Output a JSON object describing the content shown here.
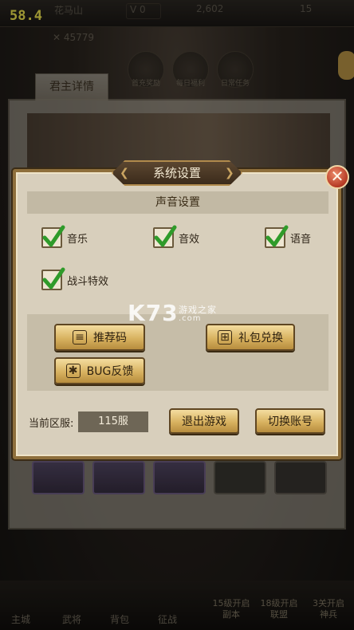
{
  "fps": "58.4",
  "topbar": {
    "lord_name": "花马山",
    "vip": "V 0",
    "coins": "2,602",
    "gems": "15",
    "power": "45779"
  },
  "background_icons": [
    "首充奖励",
    "每日福利",
    "日常任务"
  ],
  "lord_tab": "君主详情",
  "bottom_nav": {
    "items": [
      "主城",
      "武将",
      "背包",
      "征战"
    ],
    "locked": [
      {
        "line1": "15级开启",
        "line2": "副本"
      },
      {
        "line1": "18级开启",
        "line2": "联盟"
      },
      {
        "line1": "3关开启",
        "line2": "神兵"
      }
    ]
  },
  "dialog": {
    "title": "系统设置",
    "sound_section": "声音设置",
    "checkboxes": [
      {
        "label": "音乐",
        "checked": true
      },
      {
        "label": "音效",
        "checked": true
      },
      {
        "label": "语音",
        "checked": true
      },
      {
        "label": "战斗特效",
        "checked": true
      }
    ],
    "buttons": {
      "referral": "推荐码",
      "gift_redeem": "礼包兑换",
      "bug_report": "BUG反馈",
      "exit_game": "退出游戏",
      "switch_account": "切换账号"
    },
    "server_label": "当前区服:",
    "server_value": "115服"
  },
  "watermark": {
    "brand": "K73",
    "cn": "游戏之家",
    "url": ".com"
  },
  "colors": {
    "check_green": "#2f9b2a",
    "close_red": "#b53a24",
    "button_gold": "#d8b260"
  }
}
